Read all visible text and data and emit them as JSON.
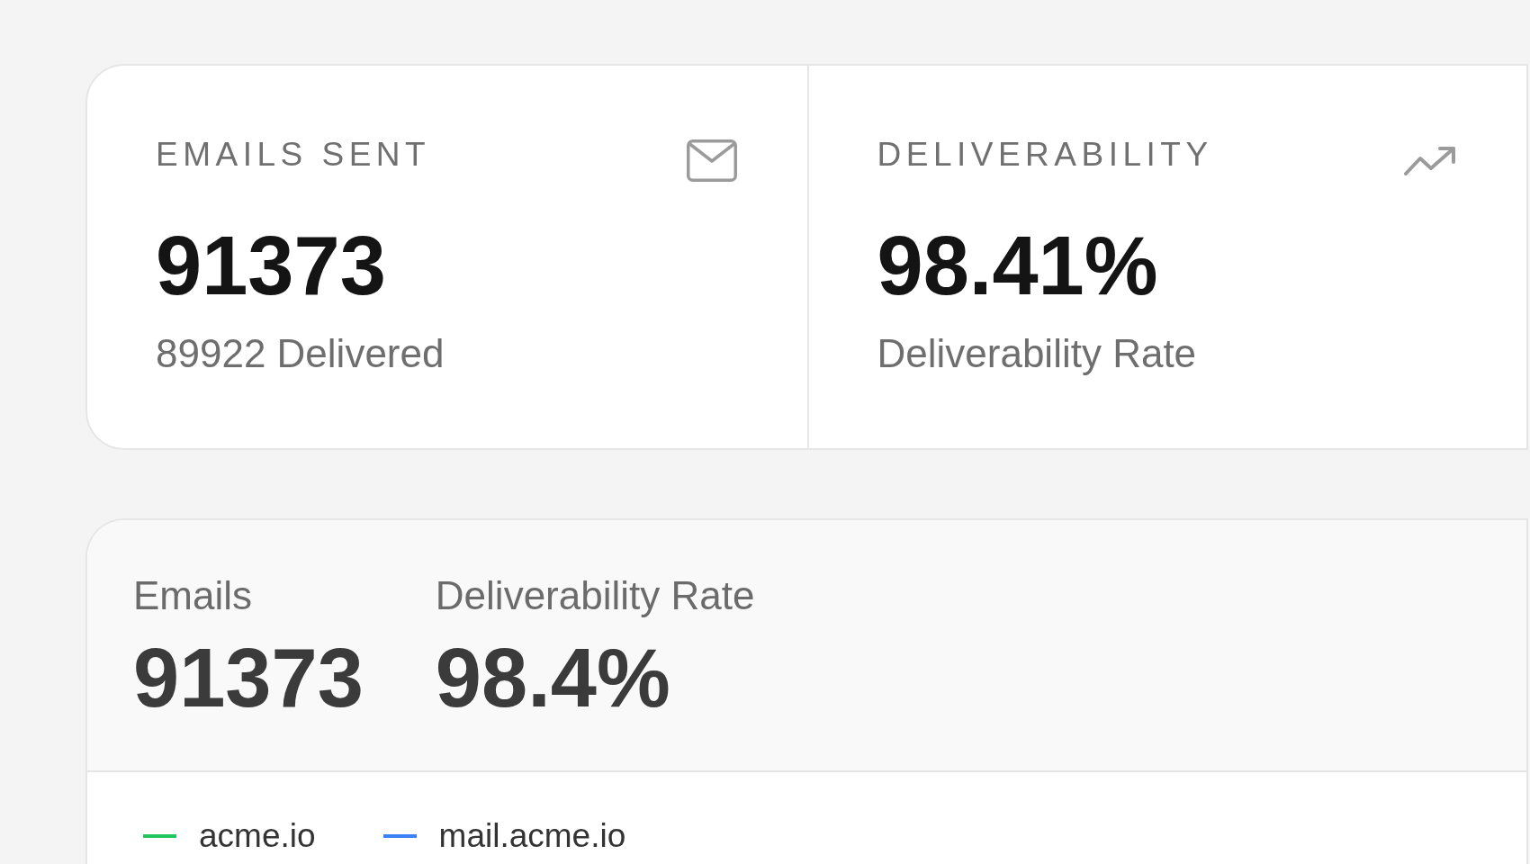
{
  "stat_cards": [
    {
      "kind": "volume",
      "label": "EMAILS SENT",
      "value": "91373",
      "caption": "89922 Delivered"
    },
    {
      "kind": "rate",
      "label": "DELIVERABILITY",
      "value": "98.41%",
      "caption": "Deliverability Rate"
    }
  ],
  "chart_panel": {
    "summary": [
      {
        "label": "Emails",
        "value": "91373"
      },
      {
        "label": "Deliverability Rate",
        "value": "98.4%"
      }
    ],
    "legend": [
      {
        "name": "acme.io",
        "color": "#22c55e"
      },
      {
        "name": "mail.acme.io",
        "color": "#3b82f6"
      }
    ]
  }
}
